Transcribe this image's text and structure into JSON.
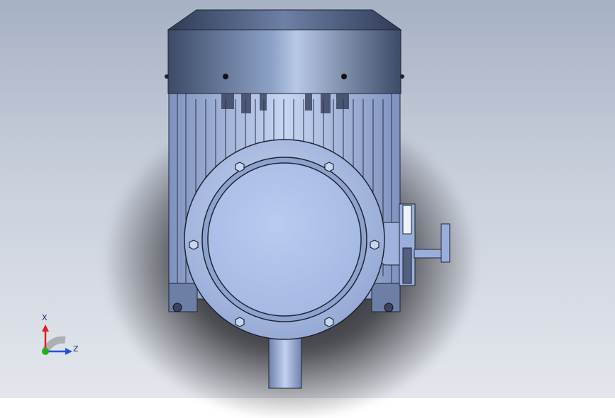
{
  "triad": {
    "x_axis_label": "X",
    "z_axis_label": "Z"
  },
  "colors": {
    "background_top": "#a6b1c4",
    "background_bottom": "#e3e6ec",
    "part_body": "#a9bde8",
    "part_edge": "#1e2433",
    "fan_cover": "#5a6a8a",
    "axis_x": "#e02020",
    "axis_y": "#20b020",
    "axis_z": "#2050e0"
  }
}
